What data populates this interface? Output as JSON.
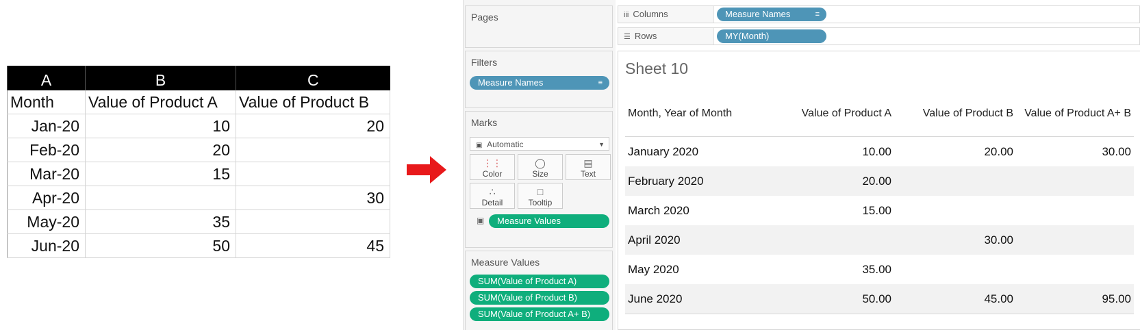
{
  "excel": {
    "col_headers": [
      "A",
      "B",
      "C"
    ],
    "rows": [
      [
        "Month",
        "Value of Product A",
        "Value of Product B"
      ],
      [
        "Jan-20",
        "10",
        "20"
      ],
      [
        "Feb-20",
        "20",
        ""
      ],
      [
        "Mar-20",
        "15",
        ""
      ],
      [
        "Apr-20",
        "",
        "30"
      ],
      [
        "May-20",
        "35",
        ""
      ],
      [
        "Jun-20",
        "50",
        "45"
      ]
    ]
  },
  "arrow_color": "#e8191b",
  "tableau": {
    "pages_label": "Pages",
    "filters_label": "Filters",
    "filter_pill": "Measure Names",
    "marks_label": "Marks",
    "mark_type": "Automatic",
    "mark_buttons": [
      "Color",
      "Size",
      "Text",
      "Detail",
      "Tooltip"
    ],
    "marks_pill": "Measure Values",
    "measure_values_label": "Measure Values",
    "measure_pills": [
      "SUM(Value of Product A)",
      "SUM(Value of Product B)",
      "SUM(Value of Product A+ B)"
    ],
    "columns_label": "Columns",
    "columns_pill": "Measure Names",
    "rows_label": "Rows",
    "rows_pill": "MY(Month)",
    "sheet_title": "Sheet 10",
    "view_headers": [
      "Month, Year of Month",
      "Value of Product A",
      "Value of Product B",
      "Value of Product A+ B"
    ],
    "view_rows": [
      [
        "January 2020",
        "10.00",
        "20.00",
        "30.00"
      ],
      [
        "February 2020",
        "20.00",
        "",
        ""
      ],
      [
        "March 2020",
        "15.00",
        "",
        ""
      ],
      [
        "April 2020",
        "",
        "30.00",
        ""
      ],
      [
        "May 2020",
        "35.00",
        "",
        ""
      ],
      [
        "June 2020",
        "50.00",
        "45.00",
        "95.00"
      ]
    ],
    "colors": {
      "pill_blue": "#4e95b7",
      "pill_green": "#0fae7c"
    }
  }
}
